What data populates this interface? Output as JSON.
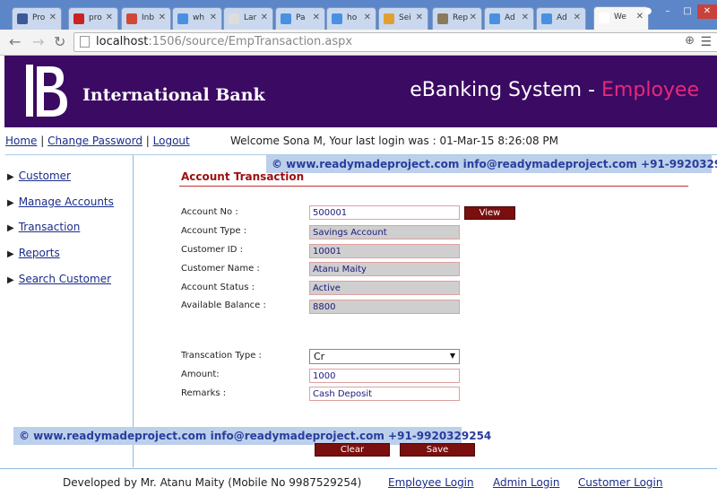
{
  "browser": {
    "tabs": [
      {
        "label": "Pro",
        "icon": "facebook-icon",
        "color": "#3b5998"
      },
      {
        "label": "pro",
        "icon": "red-icon",
        "color": "#cc2222"
      },
      {
        "label": "Inb",
        "icon": "gmail-icon",
        "color": "#d14836"
      },
      {
        "label": "wh",
        "icon": "google-icon",
        "color": "#4a90e2"
      },
      {
        "label": "Lar",
        "icon": "page-icon",
        "color": "#dddddd"
      },
      {
        "label": "Pa",
        "icon": "google-icon",
        "color": "#4a90e2"
      },
      {
        "label": "ho",
        "icon": "google-icon",
        "color": "#4a90e2"
      },
      {
        "label": "Sei",
        "icon": "search-icon",
        "color": "#e0a030"
      },
      {
        "label": "Rep",
        "icon": "image-icon",
        "color": "#8a7a5a"
      },
      {
        "label": "Ad",
        "icon": "google-icon",
        "color": "#4a90e2"
      },
      {
        "label": "Ad",
        "icon": "google-icon",
        "color": "#4a90e2"
      },
      {
        "label": "We",
        "icon": "page-icon",
        "color": "#ffffff"
      }
    ],
    "url_host": "localhost",
    "url_path": ":1506/source/EmpTransaction.aspx"
  },
  "header": {
    "bank_name": "International Bank",
    "system_title": "eBanking System - ",
    "system_role": "Employee"
  },
  "topnav": {
    "home": "Home",
    "change_password": "Change Password",
    "logout": "Logout",
    "separator": "|",
    "welcome": "Welcome Sona M, Your last login was : 01-Mar-15 8:26:08 PM"
  },
  "sidebar": {
    "items": [
      {
        "label": "Customer"
      },
      {
        "label": "Manage Accounts"
      },
      {
        "label": "Transaction"
      },
      {
        "label": "Reports"
      },
      {
        "label": "Search Customer"
      }
    ]
  },
  "watermark": "©  www.readymadeproject.com  info@readymadeproject.com  +91-9920329254",
  "form": {
    "title": "Account Transaction",
    "account_no_label": "Account No :",
    "account_no": "500001",
    "view_button": "View",
    "account_type_label": "Account Type :",
    "account_type": "Savings Account",
    "customer_id_label": "Customer ID :",
    "customer_id": "10001",
    "customer_name_label": "Customer Name :",
    "customer_name": "Atanu Maity",
    "account_status_label": "Account Status :",
    "account_status": "Active",
    "balance_label": "Available Balance :",
    "balance": "8800",
    "txn_type_label": "Transcation Type :",
    "txn_type": "Cr",
    "amount_label": "Amount:",
    "amount": "1000",
    "remarks_label": "Remarks :",
    "remarks": "Cash Deposit",
    "clear_button": "Clear",
    "save_button": "Save"
  },
  "footer": {
    "developed_by": "Developed by Mr. Atanu Maity (Mobile No 9987529254)",
    "employee_login": "Employee Login",
    "admin_login": "Admin Login",
    "customer_login": "Customer Login"
  },
  "colors": {
    "header_bg": "#3b0a63",
    "accent": "#e8287a",
    "button": "#7a0f0f"
  }
}
